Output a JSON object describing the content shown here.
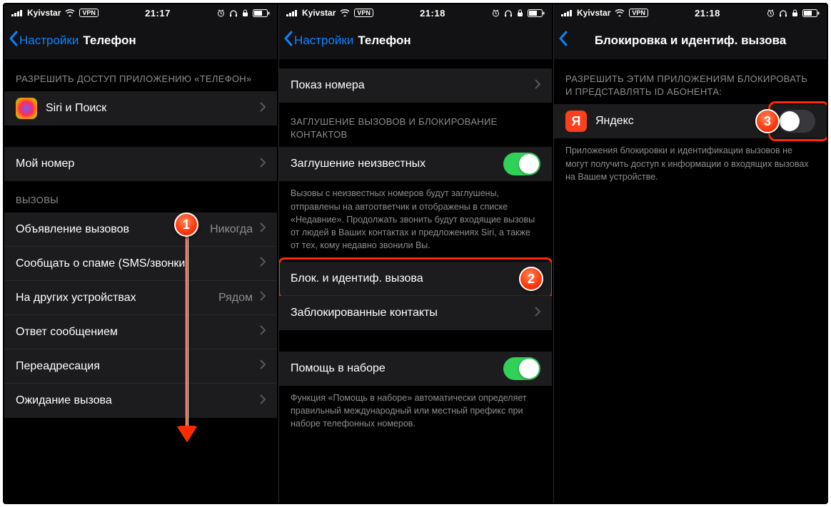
{
  "statusbar": {
    "carrier": "Kyivstar",
    "vpn": "VPN",
    "time1": "21:17",
    "time2": "21:18",
    "time3": "21:18"
  },
  "screen1": {
    "back": "Настройки",
    "title": "Телефон",
    "section_allow": "РАЗРЕШИТЬ ДОСТУП ПРИЛОЖЕНИЮ «ТЕЛЕФОН»",
    "siri": "Siri и Поиск",
    "my_number": "Мой номер",
    "section_calls": "ВЫЗОВЫ",
    "announce": "Объявление вызовов",
    "announce_val": "Никогда",
    "spam": "Сообщать о спаме (SMS/звонки)",
    "other_devices": "На других устройствах",
    "other_devices_val": "Рядом",
    "reply": "Ответ сообщением",
    "forwarding": "Переадресация",
    "waiting": "Ожидание вызова"
  },
  "screen2": {
    "back": "Настройки",
    "title": "Телефон",
    "show_id": "Показ номера",
    "section_silence": "ЗАГЛУШЕНИЕ ВЫЗОВОВ И БЛОКИРОВАНИЕ КОНТАКТОВ",
    "silence": "Заглушение неизвестных",
    "silence_footer": "Вызовы с неизвестных номеров будут заглушены, отправлены на автоответчик и отображены в списке «Недавние». Продолжать звонить будут входящие вызовы от людей в Ваших контактах и предложениях Siri, а также от тех, кому недавно звонили Вы.",
    "block_id": "Блок. и идентиф. вызова",
    "blocked": "Заблокированные контакты",
    "assist": "Помощь в наборе",
    "assist_footer": "Функция «Помощь в наборе» автоматически определяет правильный международный или местный префикс при наборе телефонных номеров."
  },
  "screen3": {
    "title": "Блокировка и идентиф. вызова",
    "section": "РАЗРЕШИТЬ ЭТИМ ПРИЛОЖЕНИЯМ БЛОКИРОВАТЬ И ПРЕДСТАВЛЯТЬ ID АБОНЕНТА:",
    "yandex": "Яндекс",
    "yandex_letter": "Я",
    "footer": "Приложения блокировки и идентификации вызовов не могут получить доступ к информации о входящих вызовах на Вашем устройстве."
  },
  "steps": {
    "one": "1",
    "two": "2",
    "three": "3"
  }
}
